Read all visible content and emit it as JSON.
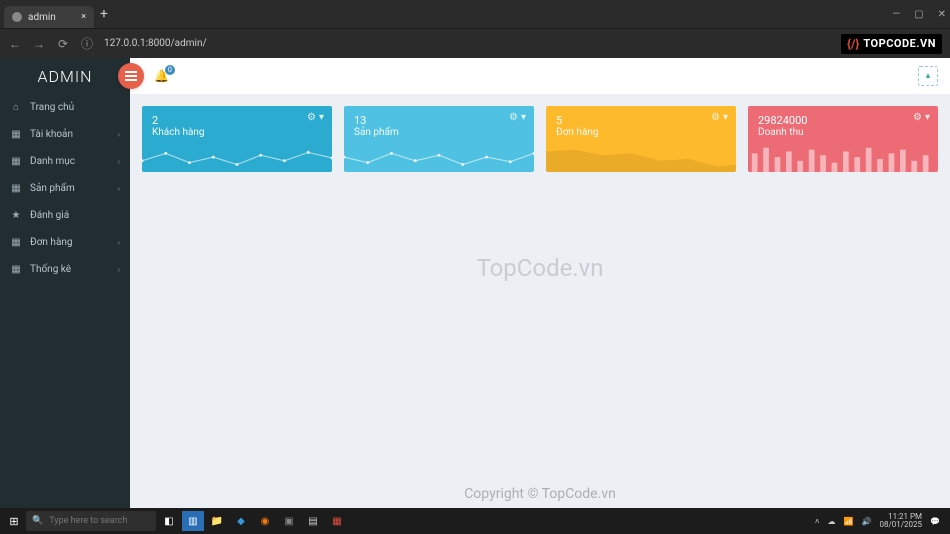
{
  "browser": {
    "tab_title": "admin",
    "url": "127.0.0.1:8000/admin/",
    "logo_text": "TOPCODE.VN"
  },
  "sidebar": {
    "brand": "ADMIN",
    "items": [
      {
        "icon": "⌂",
        "label": "Trang chủ",
        "has_sub": false
      },
      {
        "icon": "▦",
        "label": "Tài khoản",
        "has_sub": true
      },
      {
        "icon": "▦",
        "label": "Danh mục",
        "has_sub": true
      },
      {
        "icon": "▦",
        "label": "Sản phẩm",
        "has_sub": true
      },
      {
        "icon": "★",
        "label": "Đánh giá",
        "has_sub": false
      },
      {
        "icon": "▦",
        "label": "Đơn hàng",
        "has_sub": true
      },
      {
        "icon": "▦",
        "label": "Thống kê",
        "has_sub": true
      }
    ]
  },
  "topbar": {
    "notification_count": "0"
  },
  "cards": [
    {
      "value": "2",
      "label": "Khách hàng",
      "color": "#2babcf"
    },
    {
      "value": "13",
      "label": "Sản phẩm",
      "color": "#4fc1e2"
    },
    {
      "value": "5",
      "label": "Đơn hàng",
      "color": "#fdba2c"
    },
    {
      "value": "29824000",
      "label": "Doanh thu",
      "color": "#ed6b75"
    }
  ],
  "watermark": {
    "mid": "TopCode.vn",
    "bottom": "Copyright © TopCode.vn"
  },
  "taskbar": {
    "search_placeholder": "Type here to search",
    "time": "11:21 PM",
    "date": "08/01/2025"
  }
}
